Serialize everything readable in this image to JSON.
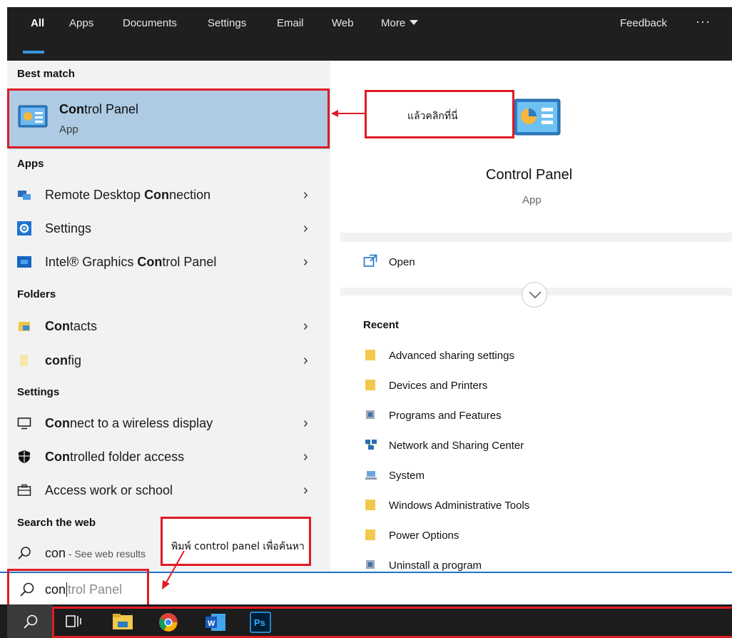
{
  "nav": {
    "tabs": [
      "All",
      "Apps",
      "Documents",
      "Settings",
      "Email",
      "Web",
      "More"
    ],
    "feedback": "Feedback",
    "ellipsis": "···"
  },
  "best_match": {
    "heading": "Best match",
    "title_bold": "Con",
    "title_rest": "trol Panel",
    "subtitle": "App"
  },
  "apps": {
    "heading": "Apps",
    "items": [
      {
        "pre": "Remote Desktop ",
        "bold": "Con",
        "post": "nection"
      },
      {
        "pre": "Settings",
        "bold": "",
        "post": ""
      },
      {
        "pre": "Intel® Graphics ",
        "bold": "Con",
        "post": "trol Panel"
      }
    ]
  },
  "folders": {
    "heading": "Folders",
    "items": [
      {
        "pre": "",
        "bold": "Con",
        "post": "tacts"
      },
      {
        "pre": "",
        "bold": "con",
        "post": "fig"
      }
    ]
  },
  "settings": {
    "heading": "Settings",
    "items": [
      {
        "pre": "",
        "bold": "Con",
        "post": "nect to a wireless display"
      },
      {
        "pre": "",
        "bold": "Con",
        "post": "trolled folder access"
      },
      {
        "pre": "Access work or school",
        "bold": "",
        "post": ""
      }
    ]
  },
  "web": {
    "heading": "Search the web",
    "query": "con",
    "suffix": " - See web results"
  },
  "detail": {
    "title": "Control Panel",
    "subtitle": "App",
    "open_label": "Open",
    "recent_heading": "Recent",
    "recent": [
      "Advanced sharing settings",
      "Devices and Printers",
      "Programs and Features",
      "Network and Sharing Center",
      "System",
      "Windows Administrative Tools",
      "Power Options",
      "Uninstall a program"
    ]
  },
  "annotations": {
    "click_here": "แล้วคลิกที่นี่",
    "type_hint": "พิมพ์ control panel เพื่อค้นหา"
  },
  "search": {
    "typed": "con",
    "completion": "trol Panel"
  },
  "colors": {
    "accent": "#3a96dd",
    "highlight": "#aecbe3",
    "annotation": "#e01b24",
    "taskbar": "#1c1c1c"
  }
}
